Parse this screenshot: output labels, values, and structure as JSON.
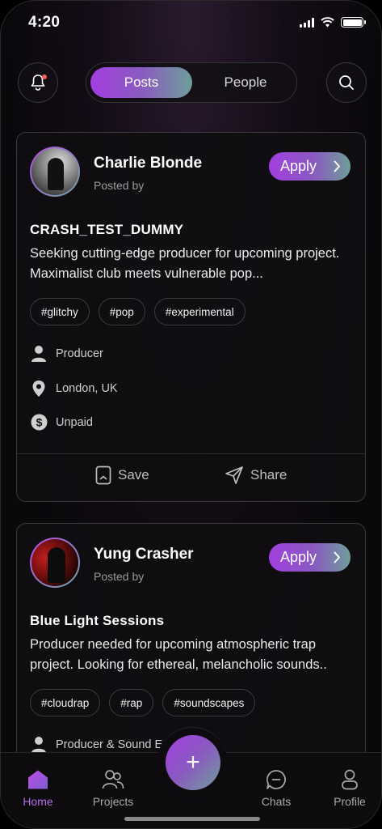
{
  "status": {
    "time": "4:20"
  },
  "segment": {
    "active_label": "Posts",
    "inactive_label": "People"
  },
  "posts": [
    {
      "name": "Charlie Blonde",
      "posted_by": "Posted by",
      "apply_label": "Apply",
      "title": "CRASH_TEST_DUMMY",
      "description": "Seeking cutting-edge producer for upcoming project. Maximalist club meets vulnerable pop...",
      "tags": [
        "#glitchy",
        "#pop",
        "#experimental"
      ],
      "role": "Producer",
      "location": "London, UK",
      "payment": "Unpaid",
      "save_label": "Save",
      "share_label": "Share"
    },
    {
      "name": "Yung Crasher",
      "posted_by": "Posted by",
      "apply_label": "Apply",
      "title": "Blue Light Sessions",
      "description": "Producer needed for upcoming atmospheric trap project. Looking for ethereal, melancholic sounds..",
      "tags": [
        "#cloudrap",
        "#rap",
        "#soundscapes"
      ],
      "role": "Producer & Sound E"
    }
  ],
  "tabbar": {
    "home": "Home",
    "projects": "Projects",
    "fab": "+",
    "chats": "Chats",
    "profile": "Profile"
  },
  "colors": {
    "accent": "#a23ee0",
    "accent_end": "#6e9e9a",
    "active_tab": "#b56be6"
  }
}
